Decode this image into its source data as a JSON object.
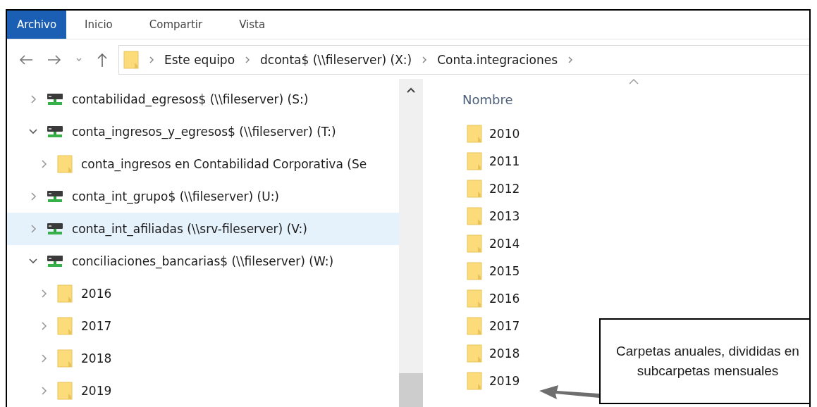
{
  "ribbon": {
    "tabs": [
      {
        "label": "Archivo",
        "selected": true
      },
      {
        "label": "Inicio",
        "selected": false
      },
      {
        "label": "Compartir",
        "selected": false
      },
      {
        "label": "Vista",
        "selected": false
      }
    ]
  },
  "address_bar": {
    "path": [
      "Este equipo",
      "dconta$ (\\\\fileserver) (X:)",
      "Conta.integraciones"
    ]
  },
  "navigation_tree": [
    {
      "label": "contabilidad_egresos$ (\\\\fileserver) (S:)",
      "kind": "drive",
      "expanded": false,
      "selected": false
    },
    {
      "label": "conta_ingresos_y_egresos$ (\\\\fileserver) (T:)",
      "kind": "drive",
      "expanded": true,
      "selected": false,
      "children": [
        {
          "label": "conta_ingresos en Contabilidad Corporativa (Se",
          "kind": "folder",
          "expanded": false,
          "selected": false
        }
      ]
    },
    {
      "label": "conta_int_grupo$ (\\\\fileserver) (U:)",
      "kind": "drive",
      "expanded": false,
      "selected": false
    },
    {
      "label": "conta_int_afiliadas (\\\\srv-fileserver) (V:)",
      "kind": "drive",
      "expanded": false,
      "selected": true
    },
    {
      "label": "conciliaciones_bancarias$ (\\\\fileserver) (W:)",
      "kind": "drive",
      "expanded": true,
      "selected": false,
      "children": [
        {
          "label": "2016",
          "kind": "folder",
          "expanded": false,
          "selected": false
        },
        {
          "label": "2017",
          "kind": "folder",
          "expanded": false,
          "selected": false
        },
        {
          "label": "2018",
          "kind": "folder",
          "expanded": false,
          "selected": false
        },
        {
          "label": "2019",
          "kind": "folder",
          "expanded": false,
          "selected": false
        }
      ]
    }
  ],
  "file_list": {
    "column": "Nombre",
    "items": [
      "2010",
      "2011",
      "2012",
      "2013",
      "2014",
      "2015",
      "2016",
      "2017",
      "2018",
      "2019"
    ]
  },
  "callout": {
    "text": "Carpetas anuales, divididas en subcarpetas mensuales"
  }
}
